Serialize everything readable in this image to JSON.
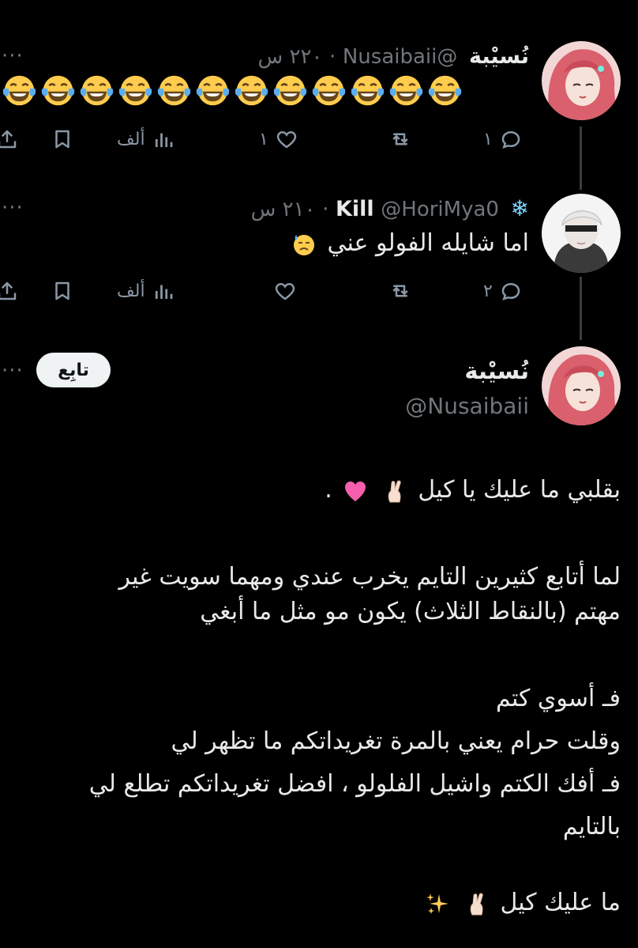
{
  "tweet1": {
    "display_name": "نُسيْبة",
    "handle": "@Nusaibaii",
    "time": "٢٢٠ س",
    "emoji_count": 12,
    "emoji_name": "face-with-tears-of-joy",
    "replies": "١",
    "retweets": "",
    "likes": "١",
    "views": "ألف"
  },
  "tweet2": {
    "display_name": "Kill",
    "name_emoji": "snowflake",
    "handle": "@HoriMya0",
    "time": "٢١٠ س",
    "text": "اما شايله الفولو عني",
    "text_emoji": "anxious-face-with-sweat",
    "replies": "٢",
    "retweets": "",
    "likes": "",
    "views": "ألف"
  },
  "main_tweet": {
    "display_name": "نُسيْبة",
    "handle": "@Nusaibaii",
    "follow_label": "تابِع",
    "lines": [
      {
        "text": "بقلبي ما عليك يا كيل",
        "emojis": [
          "crossed-fingers",
          "pink-heart"
        ],
        "suffix": "."
      },
      {
        "text": "لما أتابع كثيرين التايم يخرب عندي ومهما سويت غير"
      },
      {
        "text": "مهتم (بالنقاط الثلاث) يكون مو مثل ما أبغي"
      },
      {
        "text": "فـ أسوي كتم"
      },
      {
        "text": "وقلت حرام يعني بالمرة تغريداتكم ما تظهر لي"
      },
      {
        "text": "فـ أفك الكتم واشيل الفلولو ، افضل تغريداتكم تطلع لي"
      },
      {
        "text": "بالتايم"
      },
      {
        "text": "ما عليك كيل",
        "emojis": [
          "crossed-fingers",
          "sparkles"
        ]
      }
    ]
  },
  "colors": {
    "background": "#000000",
    "text": "#e7e9ea",
    "muted": "#71767b",
    "icon": "#8b98a5",
    "thread_line": "#3a3d40",
    "follow_bg": "#eff3f4"
  }
}
